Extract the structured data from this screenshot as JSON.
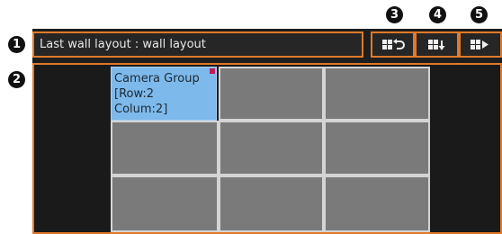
{
  "callouts": [
    "1",
    "2",
    "3",
    "4",
    "5"
  ],
  "header": {
    "label": "Last wall layout : wall layout"
  },
  "toolbar": {
    "buttons": [
      {
        "name": "restore-layout",
        "icon": "grid-undo-icon"
      },
      {
        "name": "save-layout",
        "icon": "grid-download-icon"
      },
      {
        "name": "apply-layout",
        "icon": "grid-play-icon"
      }
    ]
  },
  "wall": {
    "rows": 3,
    "columns": 3,
    "group": {
      "line1": "Camera Group",
      "line2": "[Row:2",
      "line3": "Colum:2]"
    }
  },
  "colors": {
    "accent": "#e07a2a",
    "panel": "#1e1e1e",
    "cell": "#7a7a7a",
    "group": "#7db9ea",
    "flag": "#c2185b"
  }
}
